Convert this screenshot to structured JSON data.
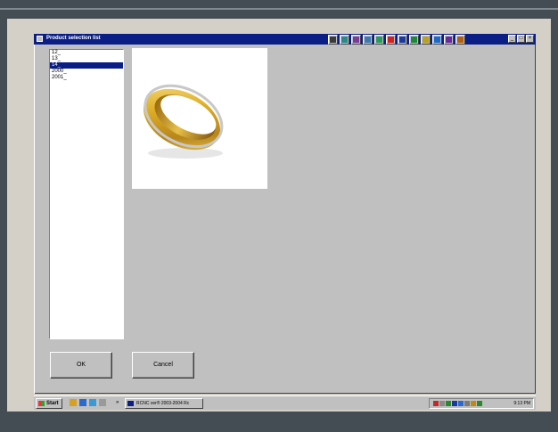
{
  "window": {
    "title": "Product selection list",
    "controls": [
      "_",
      "□",
      "×"
    ]
  },
  "toolbar_icons": [
    {
      "name": "hand-tool-icon",
      "color": "#3a3a3a"
    },
    {
      "name": "zoom-tool-icon",
      "color": "#2a8a8a"
    },
    {
      "name": "brush-tool-icon",
      "color": "#7a3a9a"
    },
    {
      "name": "edit-tool-icon",
      "color": "#3a7ab0"
    },
    {
      "name": "draw-tool-icon",
      "color": "#2a9a5a"
    },
    {
      "name": "red-marker-icon",
      "color": "#d22222"
    },
    {
      "name": "window-icon",
      "color": "#1a3aa0"
    },
    {
      "name": "grid-icon",
      "color": "#1a8a3a"
    },
    {
      "name": "pencil-icon",
      "color": "#b8a020"
    },
    {
      "name": "blue-book-icon",
      "color": "#1a6ac8"
    },
    {
      "name": "book-icon",
      "color": "#6a2a9a"
    },
    {
      "name": "settings-icon",
      "color": "#b06010"
    }
  ],
  "list": {
    "items": [
      "12_",
      "13_",
      "14_",
      "2000_",
      "2001_"
    ],
    "selected_index": 2
  },
  "buttons": {
    "ok": "OK",
    "cancel": "Cancel"
  },
  "taskbar": {
    "start": "Start",
    "more": "»",
    "task_button": "RCNC ver® 2003-2004 Rc",
    "clock": "9:13 PM",
    "quick_launch": [
      {
        "name": "desktop-icon",
        "color": "#d8a020"
      },
      {
        "name": "ie-icon",
        "color": "#2a6ad0"
      },
      {
        "name": "outlook-icon",
        "color": "#3a9ad8"
      },
      {
        "name": "media-icon",
        "color": "#9a9a9a"
      }
    ],
    "tray_icons": [
      {
        "name": "printer-icon",
        "color": "#c02a2a"
      },
      {
        "name": "volume-icon",
        "color": "#8a8a8a"
      },
      {
        "name": "network-icon",
        "color": "#2a8a2a"
      },
      {
        "name": "monitor-icon",
        "color": "#1a3aa0"
      },
      {
        "name": "messenger-icon",
        "color": "#2a6ad0"
      },
      {
        "name": "keyboard-icon",
        "color": "#7a7a7a"
      },
      {
        "name": "shield-icon",
        "color": "#c08a10"
      },
      {
        "name": "antivirus-icon",
        "color": "#2a8a2a"
      }
    ]
  }
}
